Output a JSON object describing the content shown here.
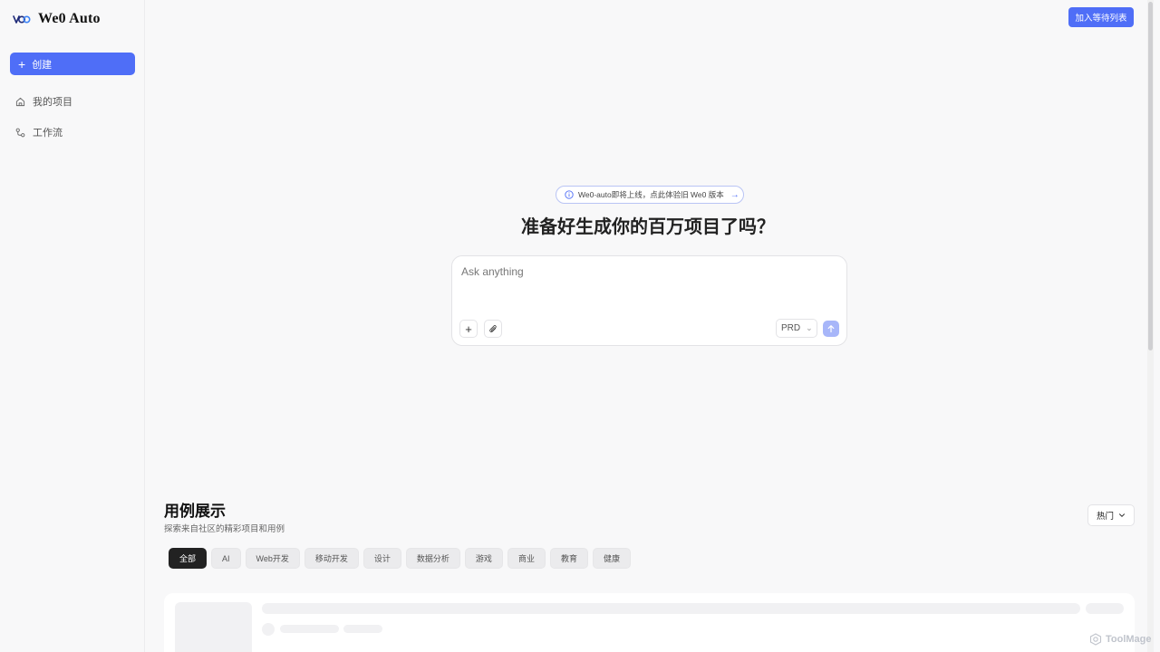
{
  "app": {
    "name": "We0 Auto"
  },
  "sidebar": {
    "create_label": "创建",
    "items": [
      {
        "label": "我的项目",
        "icon": "home-icon"
      },
      {
        "label": "工作流",
        "icon": "workflow-icon"
      }
    ]
  },
  "header": {
    "waitlist_label": "加入等待列表"
  },
  "notice": {
    "text": "We0-auto即将上线，点此体验旧 We0 版本"
  },
  "hero": {
    "headline": "准备好生成你的百万项目了吗？"
  },
  "prompt": {
    "placeholder": "Ask anything",
    "mode": "PRD"
  },
  "showcase": {
    "title": "用例展示",
    "subtitle": "探索来自社区的精彩项目和用例",
    "sort_label": "热门",
    "chips": [
      "全部",
      "AI",
      "Web开发",
      "移动开发",
      "设计",
      "数据分析",
      "游戏",
      "商业",
      "教育",
      "健康"
    ]
  },
  "watermark": {
    "text": "ToolMage"
  },
  "colors": {
    "accent": "#4f6ef7",
    "send_disabled": "#a7b6f9",
    "chip_active": "#222222"
  }
}
